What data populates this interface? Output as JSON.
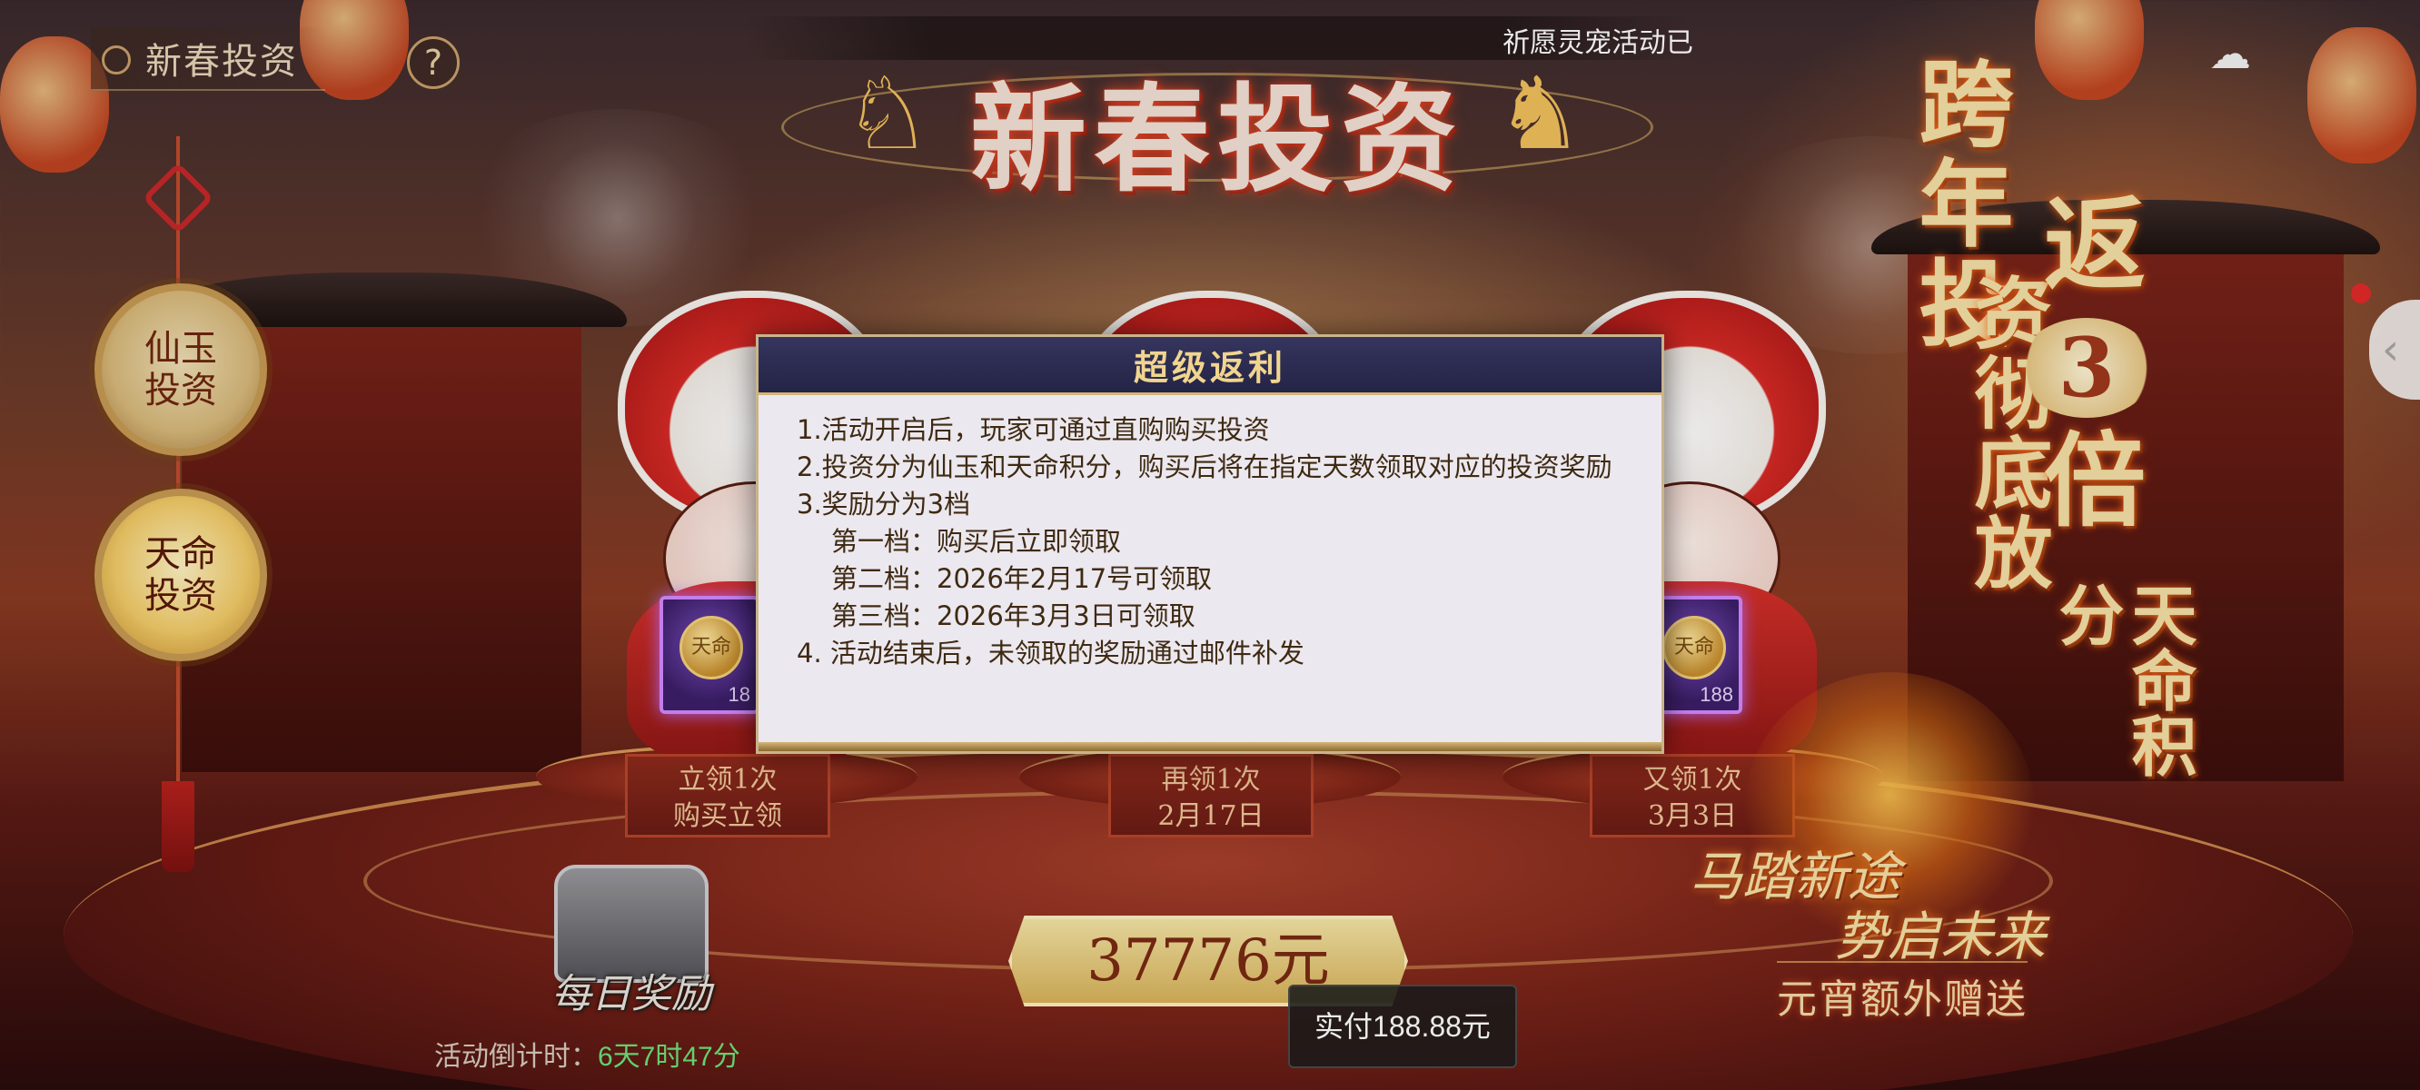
{
  "app": {
    "title": "新春投资",
    "help_icon": "question-circle-icon"
  },
  "top_marquee": "祈愿灵宠活动已",
  "banner": {
    "main_title": "新春投资"
  },
  "nav": {
    "items": [
      {
        "label": "仙玉投资",
        "active": false
      },
      {
        "label": "天命投资",
        "active": true
      }
    ]
  },
  "slogans": {
    "vertical_a": "跨年投",
    "vertical_b": "资彻底放",
    "vertical_c": "返",
    "badge_number": "3",
    "vertical_d": "倍",
    "vertical_e": "天命积分",
    "line1": "马踏新途",
    "line2": "势启未来",
    "line3": "元宵额外赠送"
  },
  "tiers": [
    {
      "line1": "立领1次",
      "line2": "购买立领",
      "card_value": "18"
    },
    {
      "line1": "再领1次",
      "line2": "2月17日",
      "card_value": ""
    },
    {
      "line1": "又领1次",
      "line2": "3月3日",
      "card_value": "188"
    }
  ],
  "card_coin_text": "天命",
  "daily_reward": {
    "label": "每日奖励"
  },
  "countdown": {
    "label": "活动倒计时：",
    "value": "6天7时47分"
  },
  "price": {
    "value_label": "37776元",
    "pay_label": "实付188.88元"
  },
  "dialog": {
    "title": "超级返利",
    "lines": [
      "1.活动开启后，玩家可通过直购购买投资",
      "2.投资分为仙玉和天命积分，购买后将在指定天数领取对应的投资奖励",
      "3.奖励分为3档",
      "第一档：购买后立即领取",
      "第二档：2026年2月17号可领取",
      "第三档：2026年3月3日可领取",
      "4. 活动结束后，未领取的奖励通过邮件补发"
    ]
  },
  "colors": {
    "dialog_header": "#242447",
    "dialog_title": "#f1d58e",
    "countdown_value": "#6ee07a",
    "accent_gold": "#d9b35a"
  },
  "icons": {
    "corner": "cloud-swirl-icon",
    "side_handle": "chevron-left-icon",
    "horse": "horse-icon",
    "chest": "treasure-chest-icon"
  }
}
